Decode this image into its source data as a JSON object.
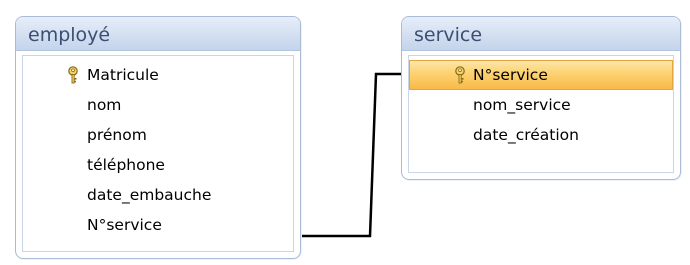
{
  "tables": [
    {
      "title": "employé",
      "fields": [
        {
          "label": "Matricule",
          "primary_key": true,
          "selected": false
        },
        {
          "label": "nom",
          "primary_key": false,
          "selected": false
        },
        {
          "label": "prénom",
          "primary_key": false,
          "selected": false
        },
        {
          "label": "téléphone",
          "primary_key": false,
          "selected": false
        },
        {
          "label": "date_embauche",
          "primary_key": false,
          "selected": false
        },
        {
          "label": "N°service",
          "primary_key": false,
          "selected": false
        }
      ]
    },
    {
      "title": "service",
      "fields": [
        {
          "label": "N°service",
          "primary_key": true,
          "selected": true
        },
        {
          "label": "nom_service",
          "primary_key": false,
          "selected": false
        },
        {
          "label": "date_création",
          "primary_key": false,
          "selected": false
        }
      ]
    }
  ],
  "relationship": {
    "from_table": "employé",
    "from_field": "N°service",
    "to_table": "service",
    "to_field": "N°service"
  },
  "colors": {
    "title_text": "#3c4f73",
    "border": "#a9bbd6",
    "selection": "#fcd270",
    "key_icon": "#e0b030"
  }
}
